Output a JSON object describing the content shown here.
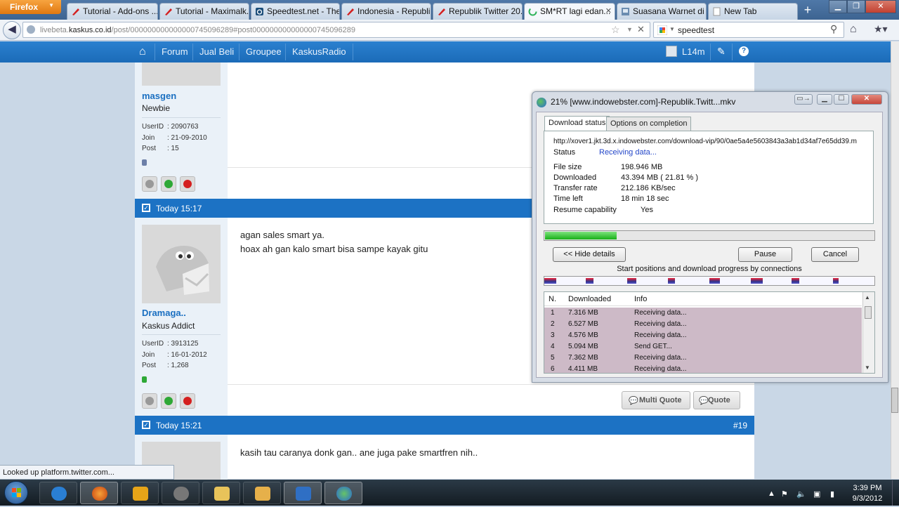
{
  "browser": {
    "menu_button": "Firefox",
    "tabs": [
      {
        "label": "Tutorial - Add-ons ...",
        "icon": "kaskus-icon",
        "color": "#d42020"
      },
      {
        "label": "Tutorial - Maximalk...",
        "icon": "kaskus-icon",
        "color": "#d42020"
      },
      {
        "label": "Speedtest.net - The...",
        "icon": "speedtest-icon",
        "color": "#1c4e7a"
      },
      {
        "label": "Indonesia - Republi...",
        "icon": "kaskus-icon",
        "color": "#d42020"
      },
      {
        "label": "Republik Twitter 20...",
        "icon": "kaskus-icon",
        "color": "#d42020"
      },
      {
        "label": "SM*RT lagi edan...",
        "icon": "loading-icon",
        "color": "#2fb35a"
      },
      {
        "label": "Suasana Warnet di ...",
        "icon": "page-icon",
        "color": "#6b8cb0"
      },
      {
        "label": "New Tab",
        "icon": "blank-page-icon",
        "color": "#ffffff"
      }
    ],
    "url_domain_prefix": "livebeta.",
    "url_domain": "kaskus.co.id",
    "url_path": "/post/000000000000000745096289#post000000000000000745096289",
    "search_value": "speedtest",
    "status_text": "Looked up platform.twitter.com..."
  },
  "site_nav": {
    "items": [
      "Forum",
      "Jual Beli",
      "Groupee",
      "KaskusRadio"
    ],
    "username": "L14m"
  },
  "posts": [
    {
      "user": "masgen",
      "rank": "Newbie",
      "userid_label": "UserID",
      "userid": ": 2090763",
      "join_label": "Join",
      "join": ": 21-09-2010",
      "post_label": "Post",
      "post": ": 15",
      "status_color": "#6d7fa8"
    },
    {
      "time": "Today 15:17",
      "user": "Dramaga..",
      "rank": "Kaskus Addict",
      "userid_label": "UserID",
      "userid": ": 3913125",
      "join_label": "Join",
      "join": ": 16-01-2012",
      "post_label": "Post",
      "post": ": 1,268",
      "status_color": "#2ea836",
      "line1": "agan sales smart ya.",
      "line2": "hoax ah gan kalo smart bisa sampe kayak gitu",
      "multi_quote": "Multi Quote",
      "quote": "Quote"
    },
    {
      "time": "Today 15:21",
      "number": "#19",
      "text": "kasih tau caranya donk gan.. ane juga pake smartfren nih.."
    }
  ],
  "idm": {
    "title": "21% [www.indowebster.com]-Republik.Twitt...mkv",
    "tab_status": "Download status",
    "tab_options": "Options on completion",
    "url": "http://xover1.jkt.3d.x.indowebster.com/download-vip/90/0ae5a4e5603843a3ab1d34af7e65dd39.m",
    "status_label": "Status",
    "status_value": "Receiving data...",
    "file_size_label": "File size",
    "file_size": "198.946  MB",
    "downloaded_label": "Downloaded",
    "downloaded": "43.394  MB  ( 21.81 % )",
    "rate_label": "Transfer rate",
    "rate": "212.186  KB/sec",
    "time_left_label": "Time left",
    "time_left": "18 min 18 sec",
    "resume_label": "Resume capability",
    "resume": "Yes",
    "progress": 0.2181,
    "hide_details": "<< Hide details",
    "pause": "Pause",
    "cancel": "Cancel",
    "connections_caption": "Start positions and download progress by connections",
    "col_n": "N.",
    "col_downloaded": "Downloaded",
    "col_info": "Info",
    "connections": [
      {
        "n": "1",
        "downloaded": "7.316  MB",
        "info": "Receiving data..."
      },
      {
        "n": "2",
        "downloaded": "6.527  MB",
        "info": "Receiving data..."
      },
      {
        "n": "3",
        "downloaded": "4.576  MB",
        "info": "Receiving data..."
      },
      {
        "n": "4",
        "downloaded": "5.094  MB",
        "info": "Send GET..."
      },
      {
        "n": "5",
        "downloaded": "7.362  MB",
        "info": "Receiving data..."
      },
      {
        "n": "6",
        "downloaded": "4.411  MB",
        "info": "Receiving data..."
      }
    ]
  },
  "taskbar": {
    "time": "3:39 PM",
    "date": "9/3/2012",
    "apps": [
      "ie-icon",
      "firefox-icon",
      "winamp-icon",
      "chrome-like-icon",
      "explorer-icon",
      "mail-icon",
      "q-app-icon",
      "idm-icon"
    ]
  }
}
